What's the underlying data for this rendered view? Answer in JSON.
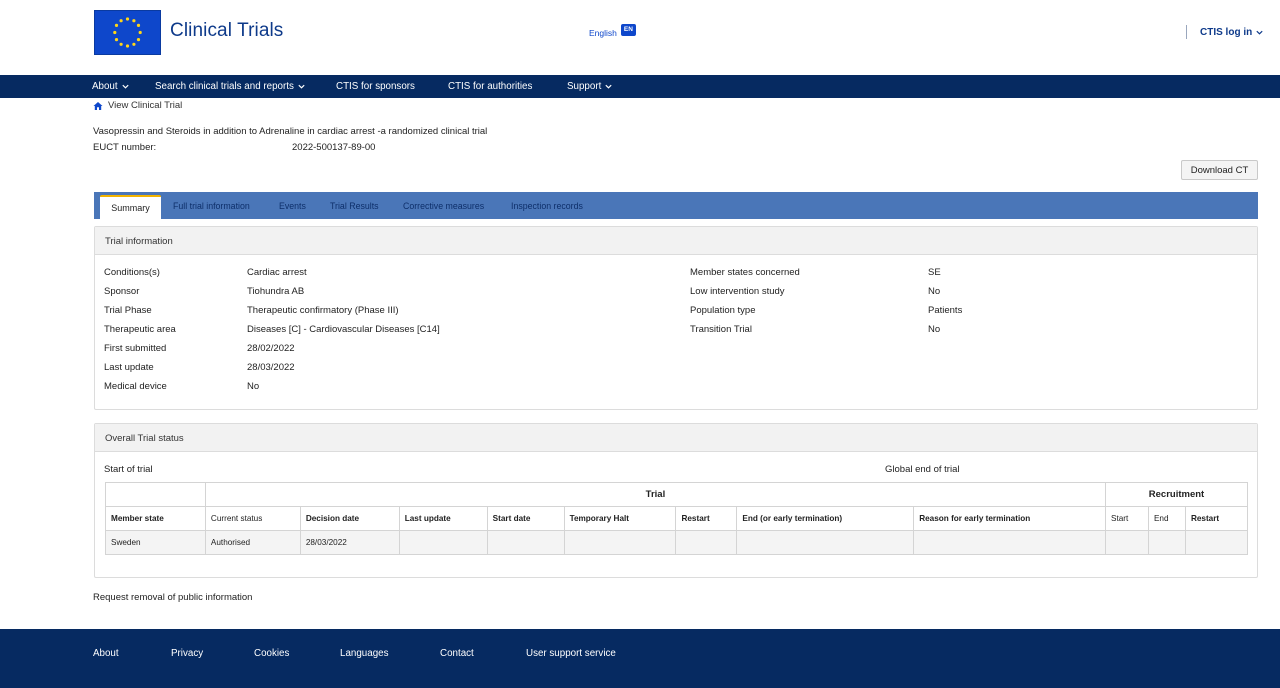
{
  "header": {
    "site_title": "Clinical Trials",
    "language": "English",
    "language_code": "EN",
    "login_label": "CTIS log in",
    "brand_color": "#062a61"
  },
  "nav": {
    "items": [
      {
        "label": "About",
        "dropdown": true
      },
      {
        "label": "Search clinical trials and reports",
        "dropdown": true
      },
      {
        "label": "CTIS for sponsors",
        "dropdown": false
      },
      {
        "label": "CTIS for authorities",
        "dropdown": false
      },
      {
        "label": "Support",
        "dropdown": true
      }
    ]
  },
  "breadcrumb": {
    "label": "View Clinical Trial"
  },
  "trial": {
    "title": "Vasopressin and Steroids in addition to Adrenaline in cardiac arrest -a randomized clinical trial",
    "euct_label": "EUCT number:",
    "euct_value": "2022-500137-89-00"
  },
  "download_label": "Download CT",
  "tabs": [
    "Summary",
    "Full trial information",
    "Events",
    "Trial Results",
    "Corrective measures",
    "Inspection records"
  ],
  "trial_info": {
    "heading": "Trial information",
    "left": [
      {
        "label": "Conditions(s)",
        "value": "Cardiac arrest"
      },
      {
        "label": "Sponsor",
        "value": "Tiohundra AB"
      },
      {
        "label": "Trial Phase",
        "value": "Therapeutic confirmatory (Phase III)"
      },
      {
        "label": "Therapeutic area",
        "value": "Diseases [C] - Cardiovascular Diseases [C14]"
      },
      {
        "label": "First submitted",
        "value": "28/02/2022"
      },
      {
        "label": "Last update",
        "value": "28/03/2022"
      },
      {
        "label": "Medical device",
        "value": "No"
      }
    ],
    "right": [
      {
        "label": "Member states concerned",
        "value": "SE"
      },
      {
        "label": "Low intervention study",
        "value": "No"
      },
      {
        "label": "Population type",
        "value": "Patients"
      },
      {
        "label": "Transition Trial",
        "value": "No"
      }
    ]
  },
  "overall_status": {
    "heading": "Overall Trial status",
    "start_label": "Start of trial",
    "end_label": "Global end of trial",
    "group_trial": "Trial",
    "group_recruitment": "Recruitment",
    "columns": [
      "Member state",
      "Current status",
      "Decision date",
      "Last update",
      "Start date",
      "Temporary Halt",
      "Restart",
      "End (or early termination)",
      "Reason for early termination",
      "Start",
      "End",
      "Restart"
    ],
    "rows": [
      [
        "Sweden",
        "Authorised",
        "28/03/2022",
        "",
        "",
        "",
        "",
        "",
        "",
        "",
        "",
        ""
      ]
    ]
  },
  "request_removal": "Request removal of public information",
  "footer": {
    "items": [
      "About",
      "Privacy",
      "Cookies",
      "Languages",
      "Contact",
      "User support service"
    ]
  }
}
